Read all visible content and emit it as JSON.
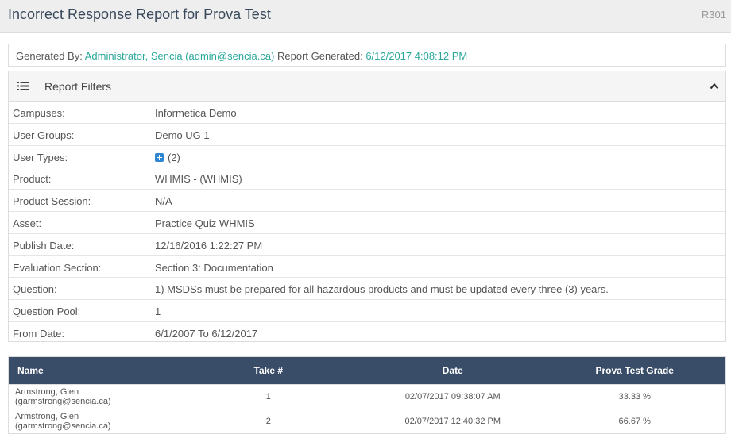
{
  "header": {
    "title": "Incorrect Response Report for Prova Test",
    "code": "R301"
  },
  "generated": {
    "by_label": "Generated By:",
    "by_value": "Administrator, Sencia (admin@sencia.ca)",
    "date_label": "Report Generated:",
    "date_value": "6/12/2017 4:08:12 PM"
  },
  "filters": {
    "title": "Report Filters",
    "rows": [
      {
        "label": "Campuses:",
        "value": "Informetica Demo"
      },
      {
        "label": "User Groups:",
        "value": "Demo UG 1"
      },
      {
        "label": "User Types:",
        "value": "(2)"
      },
      {
        "label": "Product:",
        "value": "WHMIS - (WHMIS)"
      },
      {
        "label": "Product Session:",
        "value": "N/A"
      },
      {
        "label": "Asset:",
        "value": "Practice Quiz WHMIS"
      },
      {
        "label": "Publish Date:",
        "value": "12/16/2016 1:22:27 PM"
      },
      {
        "label": "Evaluation Section:",
        "value": "Section 3: Documentation"
      },
      {
        "label": "Question:",
        "value": "1) MSDSs must be prepared for all hazardous products and must be updated every three (3) years."
      },
      {
        "label": "Question Pool:",
        "value": "1"
      },
      {
        "label": "From Date:",
        "value": "6/1/2007 To 6/12/2017"
      }
    ]
  },
  "table": {
    "headers": [
      "Name",
      "Take #",
      "Date",
      "Prova Test Grade"
    ],
    "rows": [
      [
        "Armstrong, Glen (garmstrong@sencia.ca)",
        "1",
        "02/07/2017 09:38:07 AM",
        "33.33 %"
      ],
      [
        "Armstrong, Glen (garmstrong@sencia.ca)",
        "2",
        "02/07/2017 12:40:32 PM",
        "66.67 %"
      ]
    ]
  }
}
